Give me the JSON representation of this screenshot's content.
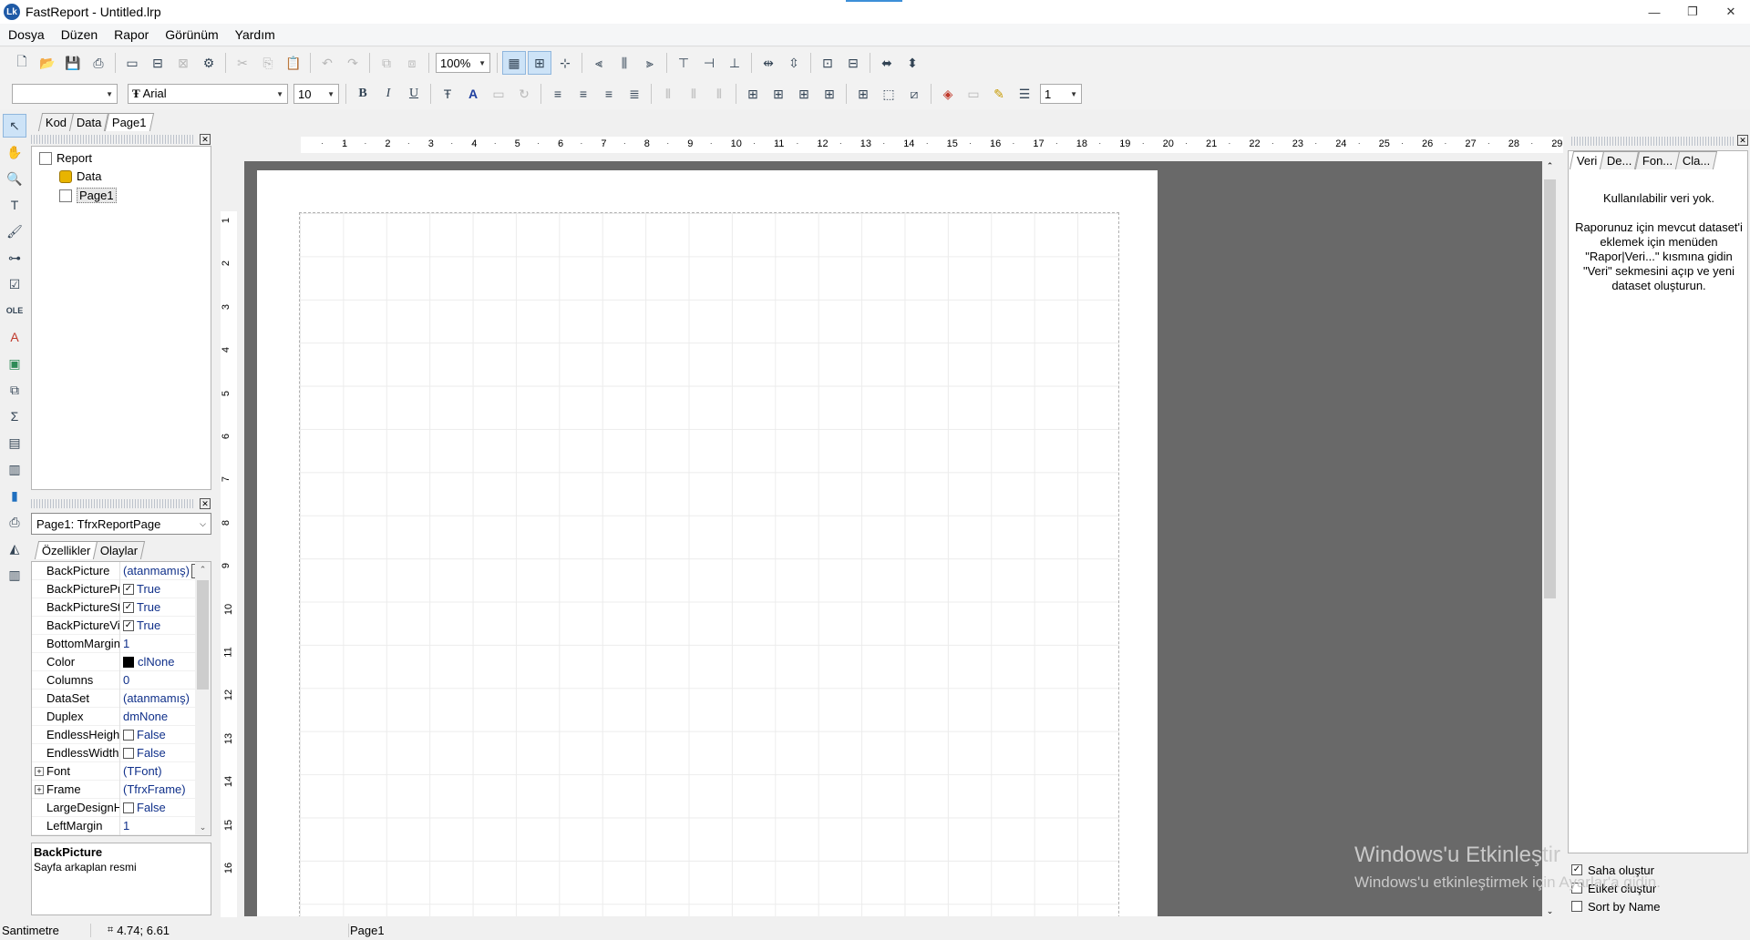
{
  "window": {
    "title": "FastReport - Untitled.lrp",
    "logo_text": "Lk",
    "minimize": "—",
    "restore": "❐",
    "close": "✕"
  },
  "menu": [
    "Dosya",
    "Düzen",
    "Rapor",
    "Görünüm",
    "Yardım"
  ],
  "toolbar1": {
    "zoom": "100%"
  },
  "toolbar2": {
    "style_value": "",
    "font_name": "Arial",
    "font_size": "10",
    "bold": "B",
    "italic": "I",
    "underline": "U",
    "line_width": "1"
  },
  "tabs": [
    "Kod",
    "Data",
    "Page1"
  ],
  "tree": {
    "root": "Report",
    "items": [
      "Data",
      "Page1"
    ]
  },
  "object_selector": "Page1: TfrxReportPage",
  "prop_tabs": [
    "Özellikler",
    "Olaylar"
  ],
  "properties": [
    {
      "name": "BackPicture",
      "value": "(atanmamış)",
      "kind": "dots"
    },
    {
      "name": "BackPicturePrintable",
      "value": "True",
      "kind": "check",
      "checked": true
    },
    {
      "name": "BackPictureStretched",
      "value": "True",
      "kind": "check",
      "checked": true
    },
    {
      "name": "BackPictureVisible",
      "value": "True",
      "kind": "check",
      "checked": true
    },
    {
      "name": "BottomMargin",
      "value": "1",
      "kind": "text"
    },
    {
      "name": "Color",
      "value": "clNone",
      "kind": "color"
    },
    {
      "name": "Columns",
      "value": "0",
      "kind": "text"
    },
    {
      "name": "DataSet",
      "value": "(atanmamış)",
      "kind": "text"
    },
    {
      "name": "Duplex",
      "value": "dmNone",
      "kind": "text"
    },
    {
      "name": "EndlessHeight",
      "value": "False",
      "kind": "check",
      "checked": false
    },
    {
      "name": "EndlessWidth",
      "value": "False",
      "kind": "check",
      "checked": false
    },
    {
      "name": "Font",
      "value": "(TFont)",
      "kind": "expand"
    },
    {
      "name": "Frame",
      "value": "(TfrxFrame)",
      "kind": "expand"
    },
    {
      "name": "LargeDesignHeight",
      "value": "False",
      "kind": "check",
      "checked": false
    },
    {
      "name": "LeftMargin",
      "value": "1",
      "kind": "text"
    }
  ],
  "prop_desc": {
    "title": "BackPicture",
    "text": "Sayfa arkaplan resmi"
  },
  "ruler_h": [
    "1",
    "2",
    "3",
    "4",
    "5",
    "6",
    "7",
    "8",
    "9",
    "10",
    "11",
    "12",
    "13",
    "14",
    "15",
    "16",
    "17",
    "18",
    "19",
    "20",
    "21",
    "22",
    "23",
    "24",
    "25",
    "26",
    "27",
    "28",
    "29"
  ],
  "ruler_v": [
    "1",
    "2",
    "3",
    "4",
    "5",
    "6",
    "7",
    "8",
    "9",
    "10",
    "11",
    "12",
    "13",
    "14",
    "15",
    "16"
  ],
  "right_tabs": [
    "Veri",
    "De...",
    "Fon...",
    "Cla..."
  ],
  "data_msg": {
    "title": "Kullanılabilir veri yok.",
    "body": "Raporunuz için mevcut dataset'i eklemek için menüden \"Rapor|Veri...\" kısmına gidin \"Veri\" sekmesini açıp ve yeni dataset oluşturun."
  },
  "right_checks": [
    {
      "label": "Saha oluştur",
      "checked": true
    },
    {
      "label": "Etiket oluştur",
      "checked": false
    },
    {
      "label": "Sort by Name",
      "checked": false
    }
  ],
  "status": {
    "units": "Santimetre",
    "coords": "4.74; 6.61",
    "page": "Page1"
  },
  "watermark": {
    "line1": "Windows'u Etkinleştir",
    "line2": "Windows'u etkinleştirmek için Ayarlar'a gidin."
  }
}
